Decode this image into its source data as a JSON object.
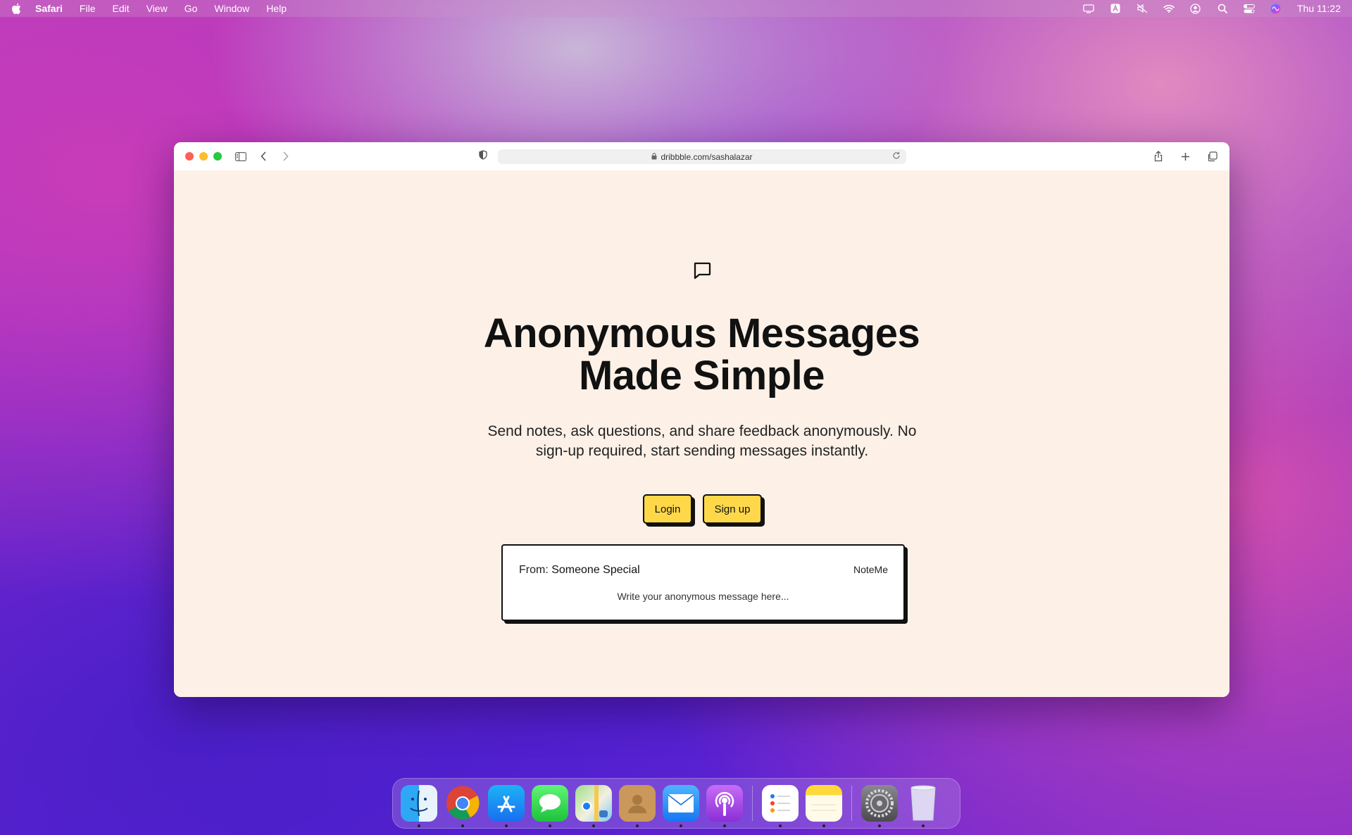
{
  "menubar": {
    "app_name": "Safari",
    "items": [
      "File",
      "Edit",
      "View",
      "Go",
      "Window",
      "Help"
    ],
    "clock": "Thu 11:22"
  },
  "browser": {
    "url": "dribbble.com/sashalazar"
  },
  "page": {
    "title_line1": "Anonymous Messages",
    "title_line2": "Made Simple",
    "subtitle": "Send notes, ask questions, and share feedback anonymously. No sign-up required, start sending messages instantly.",
    "login_label": "Login",
    "signup_label": "Sign up",
    "card": {
      "from_prefix": "From:",
      "from_name": "Someone Special",
      "brand": "NoteMe",
      "placeholder": "Write your anonymous message here..."
    },
    "colors": {
      "background": "#fdf1e7",
      "button": "#ffd84a"
    }
  },
  "dock": {
    "apps": [
      "finder-icon",
      "chrome-icon",
      "app-store-icon",
      "messages-icon",
      "maps-icon",
      "contacts-icon",
      "mail-icon",
      "podcasts-icon",
      "reminders-icon",
      "notes-icon",
      "system-settings-icon",
      "trash-icon"
    ]
  }
}
